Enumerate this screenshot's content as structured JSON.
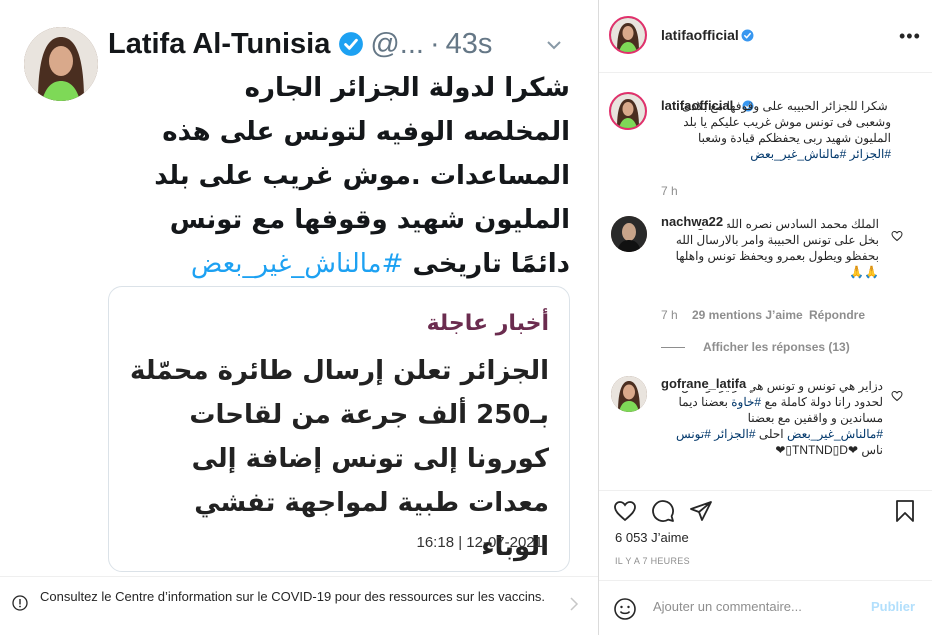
{
  "tweet": {
    "name": "Latifa Al-Tunisia",
    "handle": "@...",
    "dot": "·",
    "time": "43s",
    "text_main": "شكرا لدولة الجزائر الجاره المخلصه الوفيه لتونس على هذه المساعدات .موش غريب على بلد المليون شهيد وقوفها مع تونس دائمًا تاريخى",
    "hashtag": "#مالناش_غير_بعض",
    "card": {
      "tag": "أخبار عاجلة",
      "body": "الجزائر تعلن إرسال طائرة محمّلة بـ250 ألف جرعة من لقاحات كورونا إلى تونس إضافة إلى معدات طبية لمواجهة تفشي الوباء",
      "date": "16:18 | 12-07-2021"
    }
  },
  "covid_banner": {
    "text": "Consultez le Centre d’information sur le COVID-19 pour des ressources sur les vaccins."
  },
  "post": {
    "username": "latifaofficial",
    "more": "•••",
    "caption_user": "latifaofficial",
    "caption_text": "شكرا للجزائر الحبيبه على وقوفها مع بلادى وشعبى فى تونس موش غريب عليكم يا بلد المليون شهيد ربى يحفظكم قيادة وشعبا",
    "caption_hashtags": "#الجزائر #مالناش_غير_بعض",
    "caption_time": "7 h",
    "likes": "6 053 J’aime",
    "ago": "IL Y A 7 HEURES",
    "add_placeholder": "Ajouter un commentaire...",
    "publish": "Publier"
  },
  "comments": [
    {
      "user": "nachwa22",
      "text": "الملك محمد السادس نصره الله كمان ما بخل على تونس الحبيبة وامر بالارسال الله بحفظو ويطول بعمرو ويحفظ تونس واهلها",
      "text_suffix": "🙏🙏",
      "time": "7 h",
      "likes": "29 mentions J’aime",
      "reply": "Répondre",
      "view_replies": "Afficher les réponses (13)"
    },
    {
      "user": "gofrane_latifa",
      "text": "دزاير هي تونس و تونس هي دزاير لو مش لحدود رانا دولة كاملة مع",
      "hashtag1": "#خاوة",
      "text2": "بعضنا ديما مساندين و واقفين مع بعضنا",
      "hashtag2": "#مالناش_غير_بعض",
      "text3": "احلى",
      "hashtag3": "#الجزائر #تونس",
      "tail": "ناس ❤TNTND▯D▯❤"
    }
  ],
  "icons": {
    "verified": "verified-badge-icon",
    "heart": "heart-icon",
    "comment": "comment-icon",
    "share": "share-icon",
    "save": "bookmark-icon",
    "emoji": "emoji-icon",
    "info": "info-icon",
    "chevron": "chevron-right-icon"
  },
  "colors": {
    "verified_blue": "#3897f0",
    "twitter_blue": "#1da1f2",
    "hashtag": "#00376b",
    "muted": "#8e8e8e"
  }
}
